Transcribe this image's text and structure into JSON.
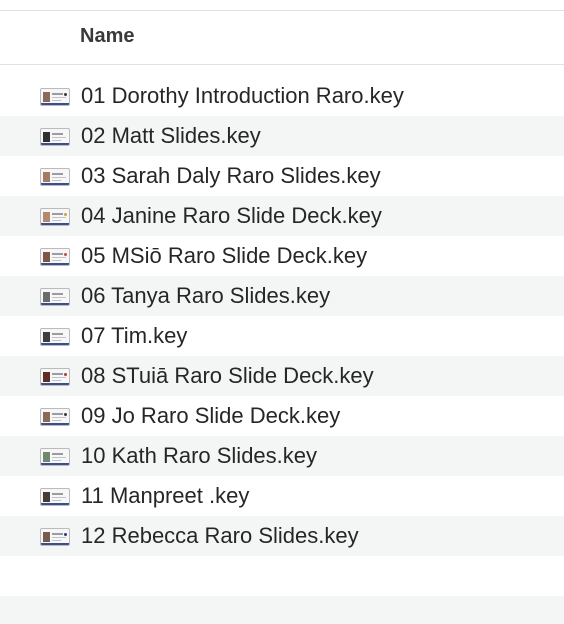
{
  "header": {
    "name_label": "Name"
  },
  "files": [
    {
      "name": "01 Dorothy Introduction Raro.key",
      "icon": "keynote-file-icon"
    },
    {
      "name": "02 Matt Slides.key",
      "icon": "keynote-file-icon"
    },
    {
      "name": "03 Sarah Daly Raro Slides.key",
      "icon": "keynote-file-icon"
    },
    {
      "name": "04 Janine Raro Slide Deck.key",
      "icon": "keynote-file-icon"
    },
    {
      "name": "05 MSiō Raro Slide Deck.key",
      "icon": "keynote-file-icon"
    },
    {
      "name": "06 Tanya Raro Slides.key",
      "icon": "keynote-file-icon"
    },
    {
      "name": "07 Tim.key",
      "icon": "keynote-file-icon"
    },
    {
      "name": "08 STuiā Raro Slide Deck.key",
      "icon": "keynote-file-icon"
    },
    {
      "name": "09 Jo Raro Slide Deck.key",
      "icon": "keynote-file-icon"
    },
    {
      "name": "10 Kath Raro Slides.key",
      "icon": "keynote-file-icon"
    },
    {
      "name": "11 Manpreet .key",
      "icon": "keynote-file-icon"
    },
    {
      "name": "12 Rebecca Raro Slides.key",
      "icon": "keynote-file-icon"
    }
  ],
  "colors": {
    "alt_row": "#f4f5f5",
    "text": "#262626",
    "header_text": "#3a3a3a"
  }
}
